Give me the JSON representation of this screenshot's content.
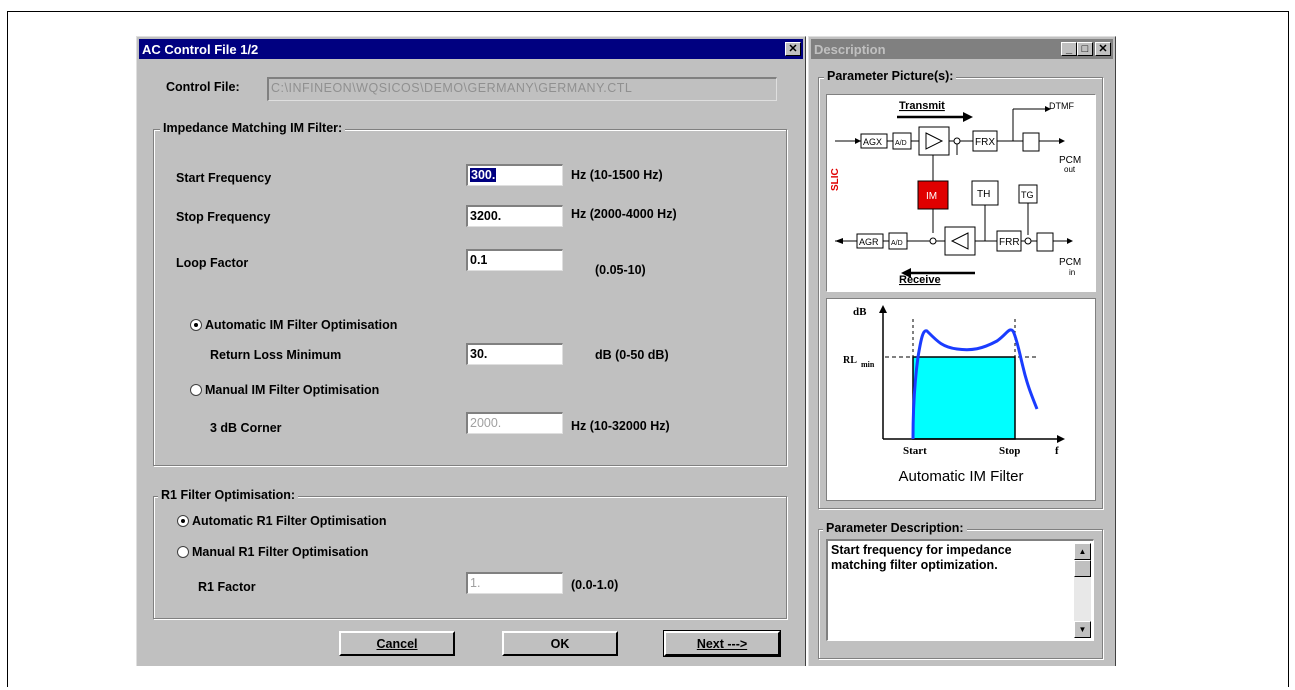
{
  "dialog": {
    "title": "AC Control File 1/2",
    "control_file_label": "Control File:",
    "control_file_value": "C:\\INFINEON\\WQSICOS\\DEMO\\GERMANY\\GERMANY.CTL",
    "im_group_title": "Impedance Matching IM Filter:",
    "start_freq_label": "Start Frequency",
    "start_freq_value": "300.",
    "start_freq_unit": "Hz (10-1500 Hz)",
    "stop_freq_label": "Stop Frequency",
    "stop_freq_value": "3200.",
    "stop_freq_unit": "Hz (2000-4000 Hz)",
    "loop_factor_label": "Loop Factor",
    "loop_factor_value": "0.1",
    "loop_factor_unit": "(0.05-10)",
    "auto_im_label": "Automatic IM Filter Optimisation",
    "return_loss_label": "Return Loss Minimum",
    "return_loss_value": "30.",
    "return_loss_unit": "dB (0-50 dB)",
    "manual_im_label": "Manual IM Filter Optimisation",
    "corner_label": "3 dB Corner",
    "corner_value": "2000.",
    "corner_unit": "Hz (10-32000 Hz)",
    "r1_group_title": "R1 Filter Optimisation:",
    "auto_r1_label": "Automatic R1 Filter Optimisation",
    "manual_r1_label": "Manual R1 Filter Optimisation",
    "r1_factor_label": "R1 Factor",
    "r1_factor_value": "1.",
    "r1_factor_unit": "(0.0-1.0)",
    "cancel_label": "Cancel",
    "ok_label": "OK",
    "next_label": "Next --->"
  },
  "description": {
    "title": "Description",
    "pictures_group_title": "Parameter Picture(s):",
    "block": {
      "transmit": "Transmit",
      "receive": "Receive",
      "dtmf": "DTMF",
      "pcm_out": "PCM",
      "pcm_out_sub": "out",
      "pcm_in": "PCM",
      "pcm_in_sub": "in",
      "slic": "SLIC",
      "agx": "AGX",
      "agr": "AGR",
      "frx": "FRX",
      "frr": "FRR",
      "im": "IM",
      "th": "TH",
      "tg": "TG",
      "ad": "A/D",
      "da": "A/D"
    },
    "plot": {
      "ylabel": "dB",
      "rl": "RL",
      "rl_sub": "min",
      "start": "Start",
      "stop": "Stop",
      "f": "f",
      "caption": "Automatic IM Filter"
    },
    "param_desc_title": "Parameter Description:",
    "param_desc_text": "Start frequency for impedance matching filter optimization."
  },
  "colors": {
    "titlebar_active": "#000080",
    "im_block": "#e00000",
    "filter_fill": "#00ffff",
    "curve": "#1a3cff"
  }
}
